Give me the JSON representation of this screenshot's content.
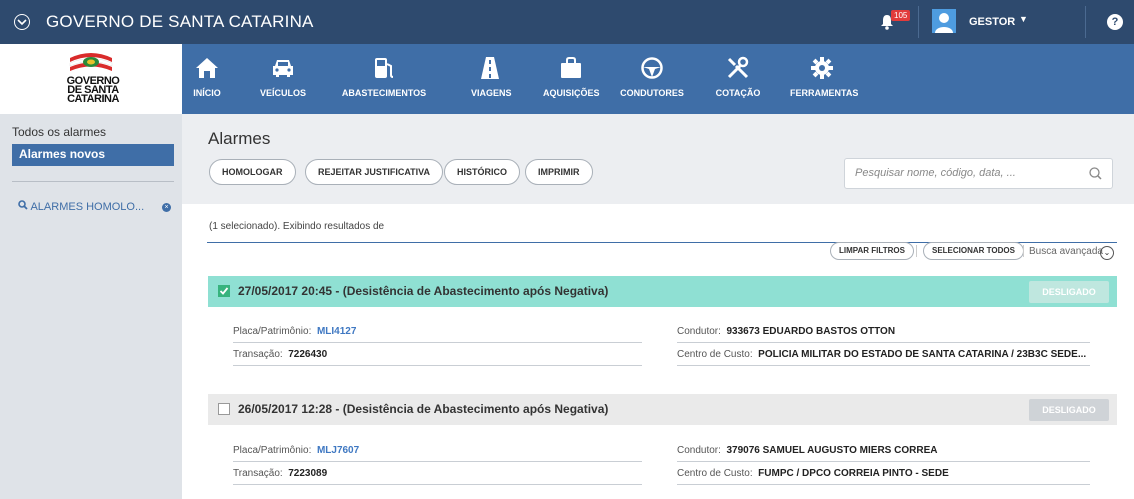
{
  "app": {
    "title": "GOVERNO DE SANTA CATARINA"
  },
  "topbar": {
    "notification_count": "105",
    "user": "GESTOR",
    "help": "?"
  },
  "logo": {
    "lines": [
      "GOVERNO",
      "DE SANTA",
      "CATARINA"
    ]
  },
  "nav": [
    {
      "label": "INÍCIO",
      "icon": "home-icon"
    },
    {
      "label": "VEÍCULOS",
      "icon": "car-icon"
    },
    {
      "label": "ABASTECIMENTOS",
      "icon": "fuel-pump-icon"
    },
    {
      "label": "VIAGENS",
      "icon": "road-icon"
    },
    {
      "label": "AQUISIÇÕES",
      "icon": "shopping-bag-icon"
    },
    {
      "label": "CONDUTORES",
      "icon": "steering-wheel-icon"
    },
    {
      "label": "COTAÇÃO",
      "icon": "tools-icon"
    },
    {
      "label": "FERRAMENTAS",
      "icon": "gear-icon"
    }
  ],
  "sidebar": {
    "items": [
      "Todos os alarmes",
      "Alarmes novos"
    ],
    "saved_search": "ALARMES HOMOLO..."
  },
  "main": {
    "title": "Alarmes",
    "buttons": [
      "HOMOLOGAR",
      "REJEITAR JUSTIFICATIVA",
      "HISTÓRICO",
      "IMPRIMIR"
    ],
    "search_placeholder": "Pesquisar nome, código, data, ...",
    "results_text": "(1 selecionado). Exibindo resultados de",
    "filter_buttons": [
      "LIMPAR FILTROS",
      "SELECIONAR TODOS"
    ],
    "advanced_search": "Busca avançada"
  },
  "alarms": [
    {
      "title": "27/05/2017 20:45 - (Desistência de Abastecimento após Negativa)",
      "selected": true,
      "status": "DESLIGADO",
      "placa_label": "Placa/Patrimônio:",
      "placa": "MLI4127",
      "transacao_label": "Transação:",
      "transacao": "7226430",
      "condutor_label": "Condutor:",
      "condutor": "933673 EDUARDO BASTOS OTTON",
      "centro_label": "Centro de Custo:",
      "centro": "POLICIA MILITAR DO ESTADO DE SANTA CATARINA / 23B3C SEDE..."
    },
    {
      "title": "26/05/2017 12:28 - (Desistência de Abastecimento após Negativa)",
      "selected": false,
      "status": "DESLIGADO",
      "placa_label": "Placa/Patrimônio:",
      "placa": "MLJ7607",
      "transacao_label": "Transação:",
      "transacao": "7223089",
      "condutor_label": "Condutor:",
      "condutor": "379076 SAMUEL AUGUSTO MIERS CORREA",
      "centro_label": "Centro de Custo:",
      "centro": "FUMPC / DPCO CORREIA PINTO - SEDE"
    }
  ],
  "colors": {
    "topbar": "#2e4a6e",
    "nav": "#3f6ea7",
    "selected_row": "#8fe0d3",
    "unselected_row": "#eaeaea"
  }
}
